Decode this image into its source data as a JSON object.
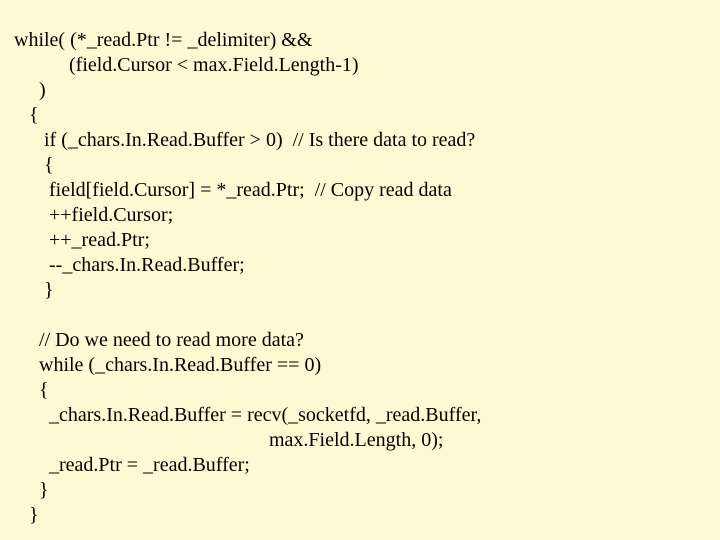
{
  "code": {
    "lines": [
      "while( (*_read.Ptr != _delimiter) &&",
      "           (field.Cursor < max.Field.Length-1)",
      "     )",
      "   {",
      "      if (_chars.In.Read.Buffer > 0)  // Is there data to read?",
      "      {",
      "       field[field.Cursor] = *_read.Ptr;  // Copy read data",
      "       ++field.Cursor;",
      "       ++_read.Ptr;",
      "       --_chars.In.Read.Buffer;",
      "      }",
      "",
      "     // Do we need to read more data?",
      "     while (_chars.In.Read.Buffer == 0)",
      "     {",
      "       _chars.In.Read.Buffer = recv(_socketfd, _read.Buffer,",
      "                                                   max.Field.Length, 0);",
      "       _read.Ptr = _read.Buffer;",
      "     }",
      "   }"
    ]
  }
}
